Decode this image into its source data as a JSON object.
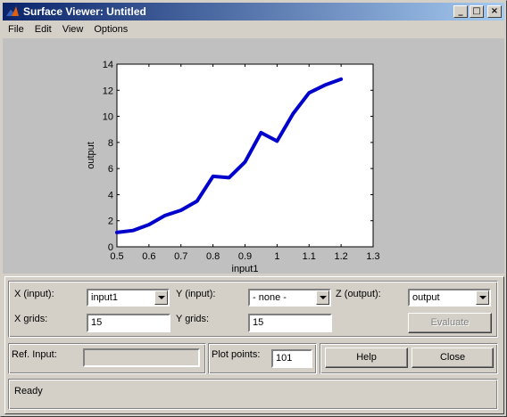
{
  "window": {
    "title": "Surface Viewer: Untitled"
  },
  "titlebar": {
    "minimize": "_",
    "maximize": "□",
    "close": "×"
  },
  "menu": [
    "File",
    "Edit",
    "View",
    "Options"
  ],
  "chart_data": {
    "type": "line",
    "xlabel": "input1",
    "ylabel": "output",
    "xlim": [
      0.5,
      1.3
    ],
    "ylim": [
      0,
      14
    ],
    "xticks": [
      0.5,
      0.6,
      0.7,
      0.8,
      0.9,
      1,
      1.1,
      1.2,
      1.3
    ],
    "yticks": [
      0,
      2,
      4,
      6,
      8,
      10,
      12,
      14
    ],
    "series": [
      {
        "color": "#0000cd",
        "x": [
          0.5,
          0.55,
          0.6,
          0.65,
          0.7,
          0.75,
          0.8,
          0.85,
          0.9,
          0.95,
          1.0,
          1.05,
          1.1,
          1.15,
          1.2
        ],
        "y": [
          1.1,
          1.25,
          1.7,
          2.4,
          2.8,
          3.5,
          5.4,
          5.3,
          6.5,
          8.75,
          8.1,
          10.2,
          11.8,
          12.4,
          12.85
        ]
      }
    ]
  },
  "controls": {
    "x_input_label": "X (input):",
    "x_input_value": "input1",
    "y_input_label": "Y (input):",
    "y_input_value": "- none -",
    "z_output_label": "Z (output):",
    "z_output_value": "output",
    "x_grids_label": "X grids:",
    "x_grids_value": "15",
    "y_grids_label": "Y grids:",
    "y_grids_value": "15",
    "evaluate_label": "Evaluate",
    "ref_input_label": "Ref. Input:",
    "ref_input_value": "",
    "plot_points_label": "Plot points:",
    "plot_points_value": "101",
    "help_label": "Help",
    "close_label": "Close",
    "status": "Ready"
  }
}
